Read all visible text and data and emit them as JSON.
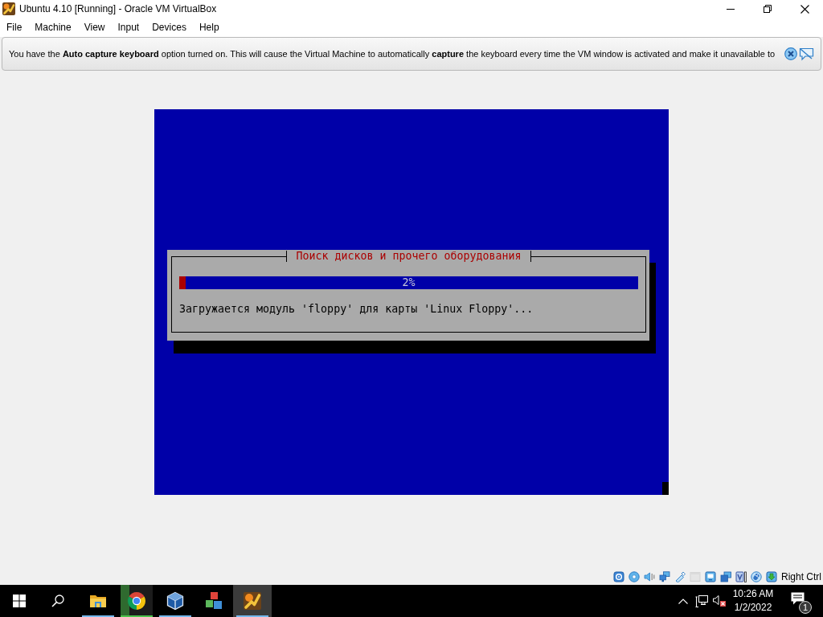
{
  "window": {
    "title": "Ubuntu 4.10 [Running] - Oracle VM VirtualBox"
  },
  "menu": [
    "File",
    "Machine",
    "View",
    "Input",
    "Devices",
    "Help"
  ],
  "notice": {
    "text": "You have the **Auto capture keyboard** option turned on. This will cause the Virtual Machine to automatically **capture** the keyboard every time the VM window is activated and make it unavailable to"
  },
  "vm_screen": {
    "dialog": {
      "title": "Поиск дисков и прочего оборудования",
      "progress": {
        "level": 0.014,
        "reading": "2%"
      },
      "message": "Загружается модуль 'floppy' для карты 'Linux Floppy'..."
    }
  },
  "status_bar": {
    "indicators": [
      {
        "kind": "hard-disk",
        "disabled": false
      },
      {
        "kind": "optical",
        "disabled": false
      },
      {
        "kind": "audio",
        "disabled": false
      },
      {
        "kind": "network",
        "disabled": false
      },
      {
        "kind": "usb",
        "disabled": false
      },
      {
        "kind": "shared-folders",
        "disabled": true
      },
      {
        "kind": "display",
        "disabled": false
      },
      {
        "kind": "capture",
        "disabled": false
      },
      {
        "kind": "recording",
        "disabled": false
      },
      {
        "kind": "mouse",
        "disabled": false
      },
      {
        "kind": "keyboard",
        "disabled": false
      }
    ],
    "host_key": "Right Ctrl"
  },
  "taskbar": {
    "apps": [
      {
        "kind": "folder",
        "running": true,
        "selected": false
      },
      {
        "kind": "browser",
        "running": true,
        "selected": false,
        "level": 0.28
      },
      {
        "kind": "cube",
        "running": true,
        "selected": false
      },
      {
        "kind": "blocks",
        "running": false,
        "selected": false
      },
      {
        "kind": "vm",
        "running": true,
        "selected": true
      }
    ],
    "tray": {
      "muted": true,
      "time": "10:26 AM",
      "date": "1/2/2022",
      "notification_count": "1"
    }
  }
}
